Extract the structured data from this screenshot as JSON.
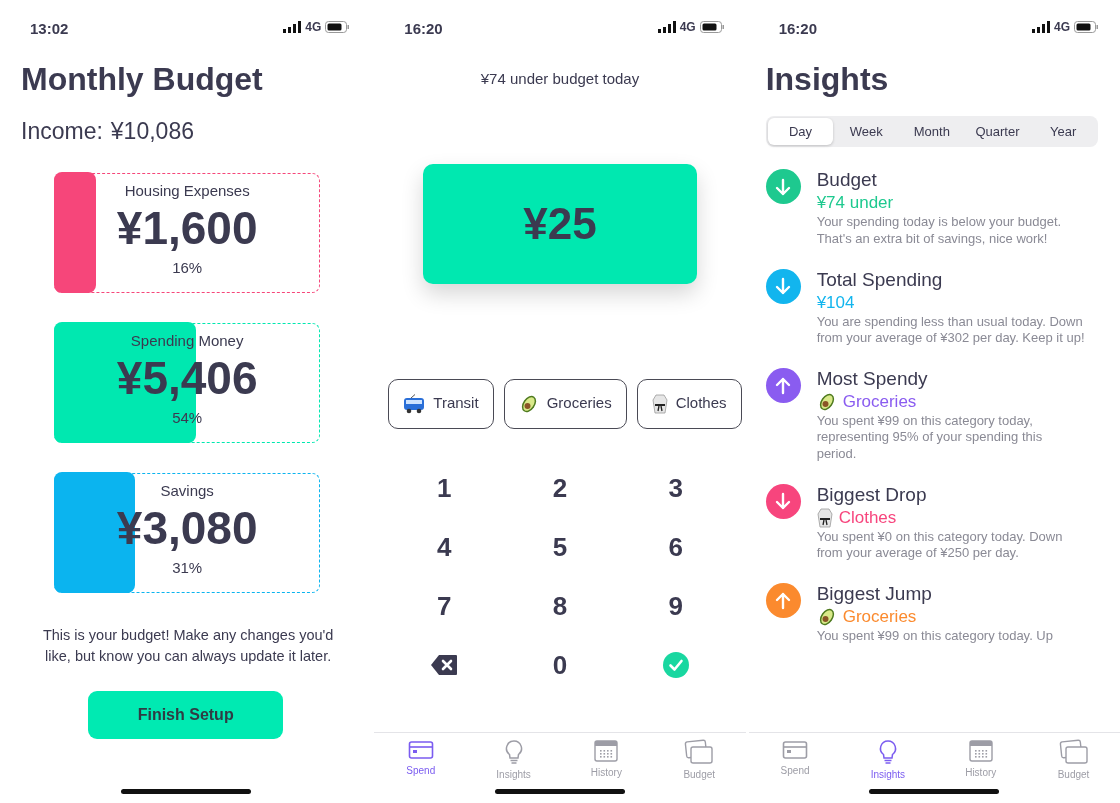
{
  "screens": [
    {
      "kind": "budget",
      "status": {
        "time": "13:02",
        "network": "4G"
      },
      "title": "Monthly Budget",
      "income_label": "Income:",
      "income": "¥10,086",
      "budgets": [
        {
          "name": "Housing Expenses",
          "amount": "¥1,600",
          "percent": "16%",
          "level": 0.16,
          "color": "#f6467a"
        },
        {
          "name": "Spending Money",
          "amount": "¥5,406",
          "percent": "54%",
          "level": 0.54,
          "color": "#00e8b0"
        },
        {
          "name": "Savings",
          "amount": "¥3,080",
          "percent": "31%",
          "level": 0.31,
          "color": "#0bb4ef"
        }
      ],
      "note": "This is your budget! Make any changes you'd like, but know you can always update it later.",
      "button": "Finish Setup"
    },
    {
      "kind": "spend",
      "status": {
        "time": "16:20",
        "network": "4G"
      },
      "summary": "¥74 under budget today",
      "amount": "¥25",
      "categories": [
        {
          "kind": "bus",
          "label": "Transit"
        },
        {
          "kind": "avocado",
          "label": "Groceries"
        },
        {
          "kind": "uniform",
          "label": "Clothes"
        }
      ],
      "keys": [
        {
          "kind": "digit",
          "label": "1"
        },
        {
          "kind": "digit",
          "label": "2"
        },
        {
          "kind": "digit",
          "label": "3"
        },
        {
          "kind": "digit",
          "label": "4"
        },
        {
          "kind": "digit",
          "label": "5"
        },
        {
          "kind": "digit",
          "label": "6"
        },
        {
          "kind": "digit",
          "label": "7"
        },
        {
          "kind": "digit",
          "label": "8"
        },
        {
          "kind": "digit",
          "label": "9"
        },
        {
          "kind": "backspace"
        },
        {
          "kind": "digit",
          "label": "0"
        },
        {
          "kind": "confirm"
        }
      ],
      "tabs": [
        {
          "kind": "card",
          "label": "Spend",
          "selected": true
        },
        {
          "kind": "bulb",
          "label": "Insights",
          "selected": false
        },
        {
          "kind": "calendar",
          "label": "History",
          "selected": false
        },
        {
          "kind": "stack",
          "label": "Budget",
          "selected": false
        }
      ]
    },
    {
      "kind": "insights",
      "status": {
        "time": "16:20",
        "network": "4G"
      },
      "title": "Insights",
      "periods": [
        {
          "label": "Day",
          "selected": true
        },
        {
          "label": "Week",
          "selected": false
        },
        {
          "label": "Month",
          "selected": false
        },
        {
          "label": "Quarter",
          "selected": false
        },
        {
          "label": "Year",
          "selected": false
        }
      ],
      "insights": [
        {
          "kind": "down",
          "color": "#1ec98f",
          "title": "Budget",
          "value": "¥74 under",
          "description": "Your spending today is below your budget. That's an extra bit of savings, nice work!"
        },
        {
          "kind": "down",
          "color": "#12b5ee",
          "title": "Total Spending",
          "value": "¥104",
          "description": "You are spending less than usual today. Down from your average of ¥302 per day. Keep it up!"
        },
        {
          "kind": "up",
          "color": "#8a5cf0",
          "title": "Most Spendy",
          "category": {
            "kind": "avocado",
            "label": "Groceries"
          },
          "description": "You spent ¥99 on this category today, representing 95% of your spending this period."
        },
        {
          "kind": "down",
          "color": "#f7457d",
          "title": "Biggest Drop",
          "category": {
            "kind": "uniform",
            "label": "Clothes"
          },
          "description": "You spent ¥0 on this category today. Down from your average of ¥250 per day."
        },
        {
          "kind": "up",
          "color": "#fb8a2e",
          "title": "Biggest Jump",
          "category": {
            "kind": "avocado",
            "label": "Groceries"
          },
          "description": "You spent ¥99 on this category today. Up"
        }
      ],
      "tabs": [
        {
          "kind": "card",
          "label": "Spend",
          "selected": false
        },
        {
          "kind": "bulb",
          "label": "Insights",
          "selected": true
        },
        {
          "kind": "calendar",
          "label": "History",
          "selected": false
        },
        {
          "kind": "stack",
          "label": "Budget",
          "selected": false
        }
      ]
    }
  ]
}
